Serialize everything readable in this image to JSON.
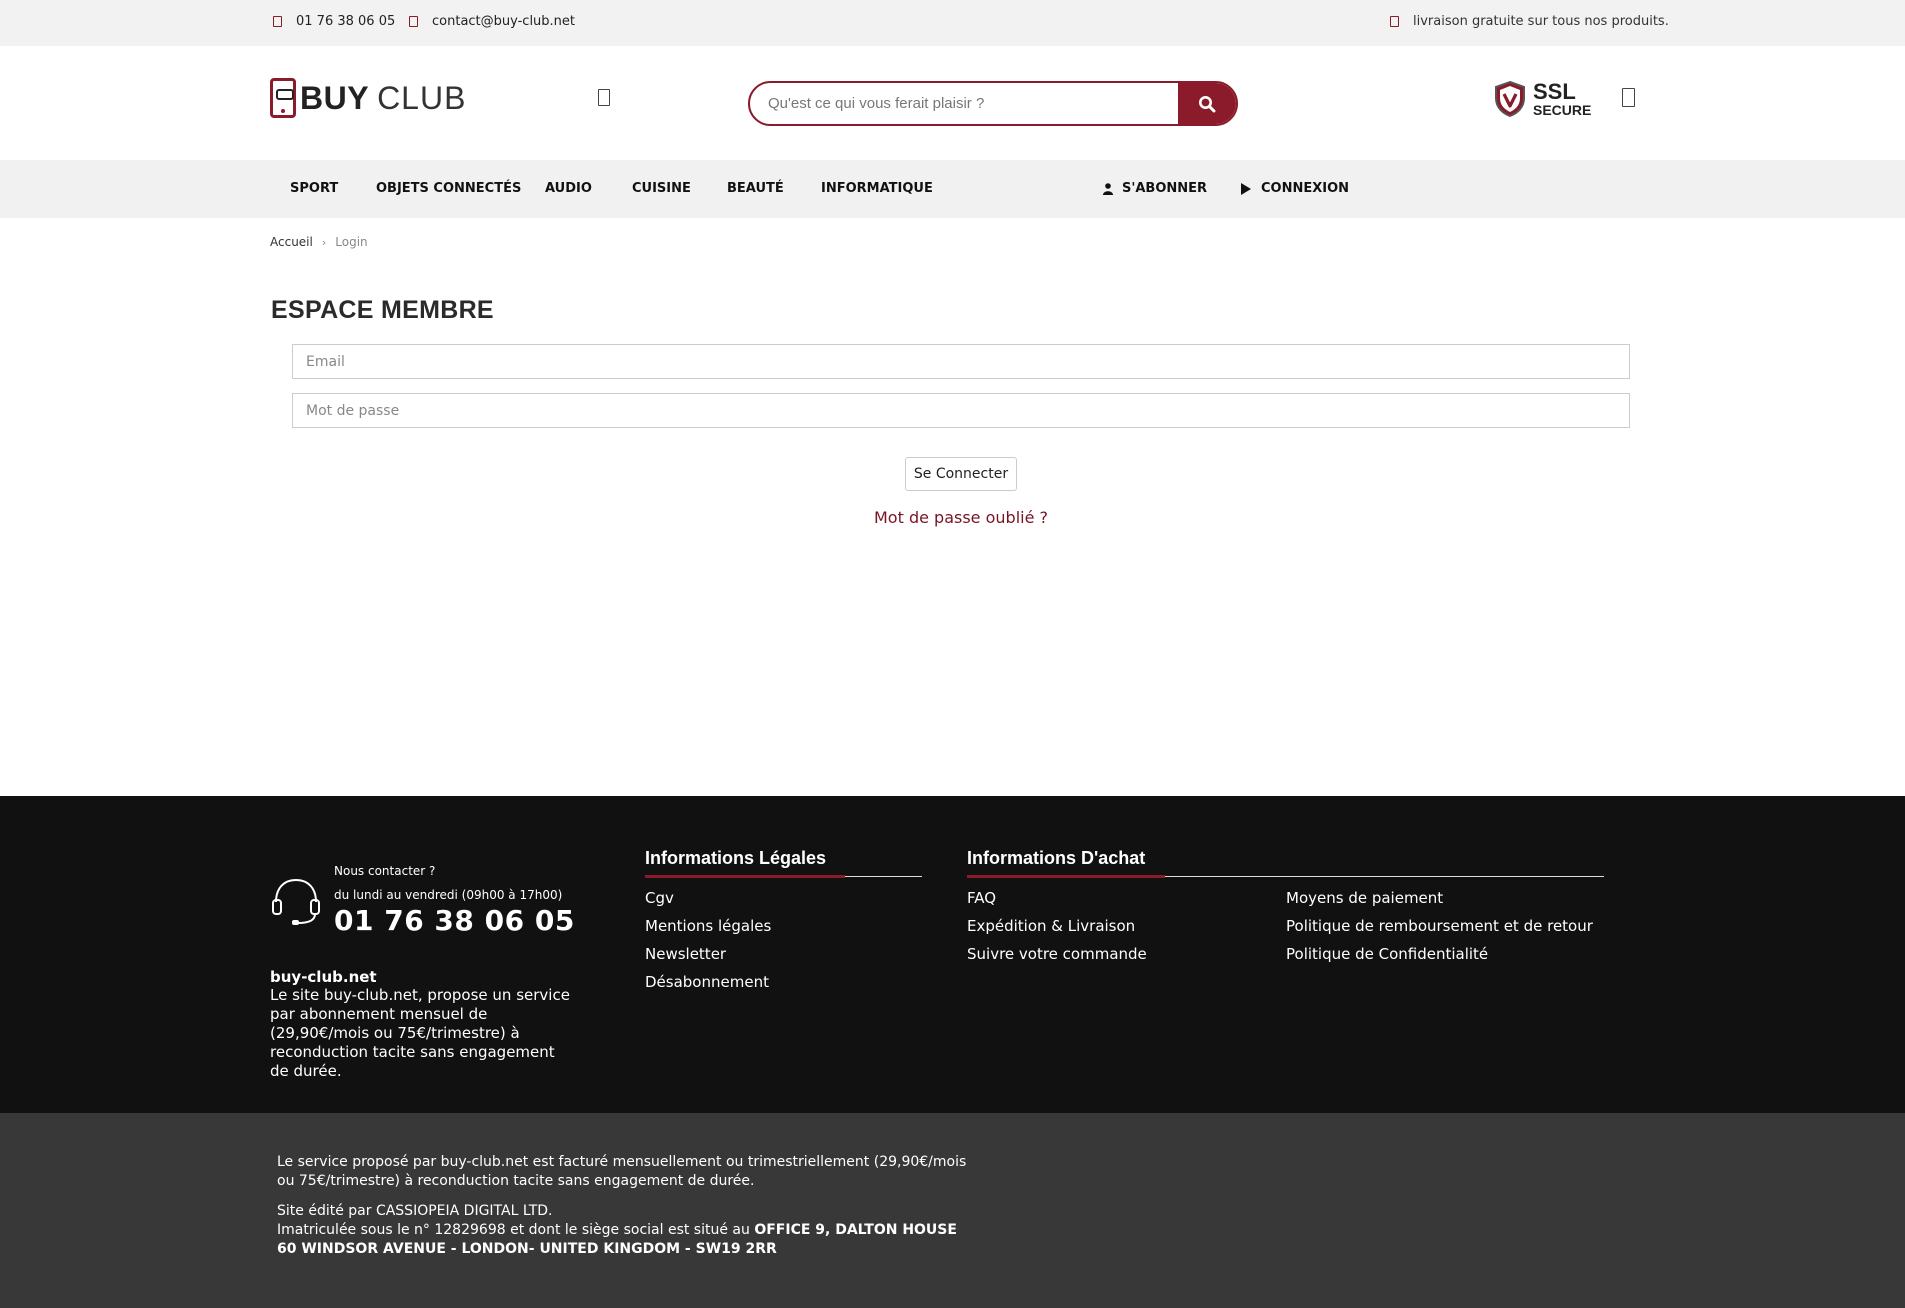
{
  "topbar": {
    "phone": "01 76 38 06 05",
    "email": "contact@buy-club.net",
    "shipping": "livraison gratuite sur tous nos produits."
  },
  "logo": {
    "part1": "BUY",
    "part2": "CLUB"
  },
  "search": {
    "placeholder": "Qu'est ce qui vous ferait plaisir ?"
  },
  "ssl": {
    "line1": "SSL",
    "line2": "SECURE"
  },
  "nav": {
    "items": [
      "SPORT",
      "OBJETS CONNECTÉS",
      "AUDIO",
      "CUISINE",
      "BEAUTÉ",
      "INFORMATIQUE"
    ],
    "subscribe": "S'ABONNER",
    "login": "CONNEXION"
  },
  "breadcrumb": {
    "home": "Accueil",
    "current": "Login"
  },
  "main": {
    "title": "ESPACE MEMBRE",
    "email_placeholder": "Email",
    "password_placeholder": "Mot de passe",
    "submit_label": "Se Connecter",
    "forgot_label": "Mot de passe oublié ?"
  },
  "footer": {
    "contact_question": "Nous contacter ?",
    "hours": "du lundi au vendredi (09h00 à 17h00)",
    "phone": "01 76 38 06 05",
    "brand": "buy-club.net",
    "description": "Le site buy-club.net, propose un service par abonnement mensuel de (29,90€/mois ou 75€/trimestre) à reconduction tacite sans engagement de durée.",
    "legal_title": "Informations Légales",
    "legal_links": [
      "Cgv",
      "Mentions légales",
      "Newsletter",
      "Désabonnement"
    ],
    "purchase_title": "Informations D'achat",
    "purchase_links_col1": [
      "FAQ",
      "Expédition & Livraison",
      "Suivre votre commande"
    ],
    "purchase_links_col2": [
      "Moyens de paiement",
      "Politique de remboursement et de retour",
      "Politique de Confidentialité"
    ]
  },
  "subfooter": {
    "billing": "Le service proposé par buy-club.net est facturé mensuellement ou trimestriellement (29,90€/mois ou 75€/trimestre) à reconduction tacite sans engagement de durée.",
    "edited_by": "Site édité par CASSIOPEIA DIGITAL LTD.",
    "registered": "Imatriculée sous le n° 12829698 et dont le siège social est situé au",
    "address": "OFFICE 9, DALTON HOUSE 60 WINDSOR AVENUE - LONDON- UNITED KINGDOM - SW19 2RR"
  },
  "colors": {
    "accent": "#8b1a2b",
    "footer_bg": "#111111",
    "subfooter_bg": "#383838",
    "nav_bg": "#f1f1f1"
  }
}
